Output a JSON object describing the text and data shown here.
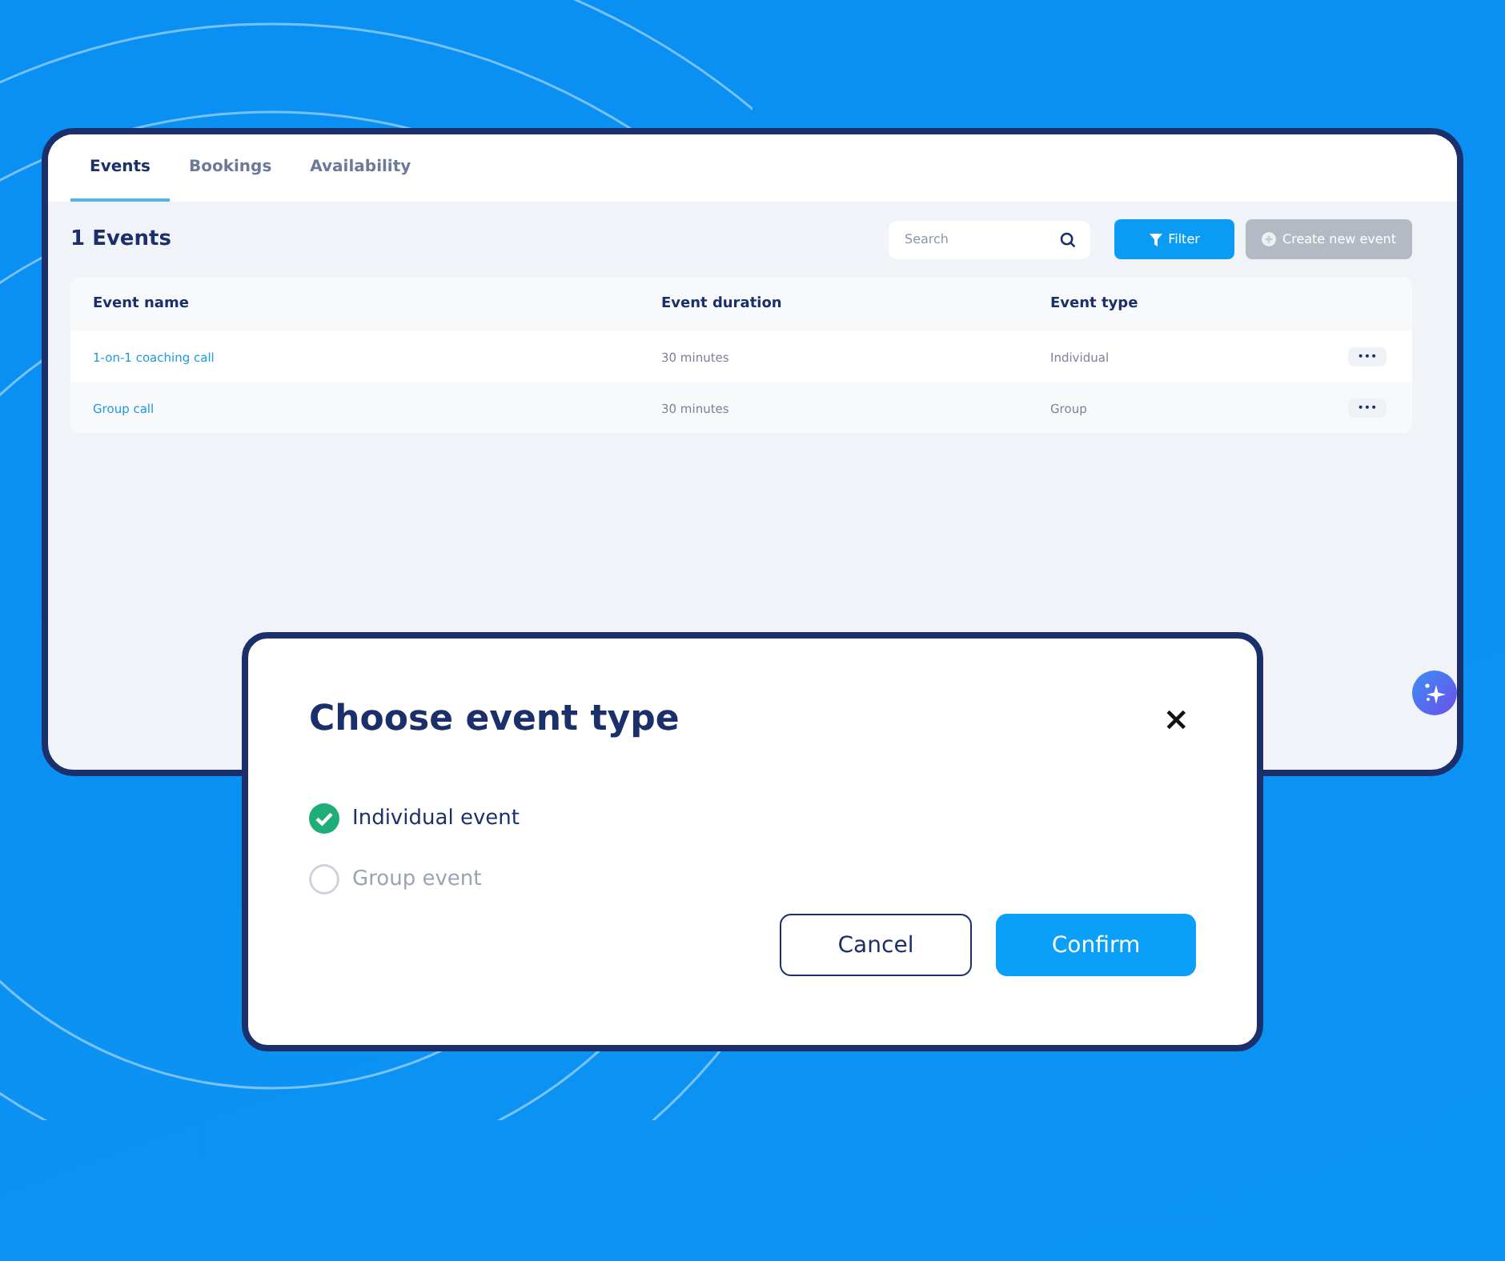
{
  "tabs": [
    {
      "label": "Events",
      "selected": true
    },
    {
      "label": "Bookings",
      "selected": false
    },
    {
      "label": "Availability",
      "selected": false
    }
  ],
  "heading": "1 Events",
  "search": {
    "placeholder": "Search"
  },
  "actions": [
    {
      "kind": "filter",
      "label": "Filter",
      "disabled": false
    },
    {
      "kind": "create",
      "label": "Create new event",
      "disabled": true
    }
  ],
  "table": {
    "columns": [
      "Event name",
      "Event duration",
      "Event type"
    ],
    "rows": [
      {
        "name": "1-on-1 coaching call",
        "duration": "30 minutes",
        "type": "Individual",
        "more": "•••"
      },
      {
        "name": "Group call",
        "duration": "30 minutes",
        "type": "Group",
        "more": "•••"
      }
    ]
  },
  "dialog": {
    "title": "Choose event type",
    "close": "×",
    "options": [
      {
        "label": "Individual event",
        "selected": true
      },
      {
        "label": "Group event",
        "selected": false
      }
    ],
    "buttons": [
      {
        "kind": "secondary",
        "label": "Cancel"
      },
      {
        "kind": "primary",
        "label": "Confirm"
      }
    ]
  }
}
